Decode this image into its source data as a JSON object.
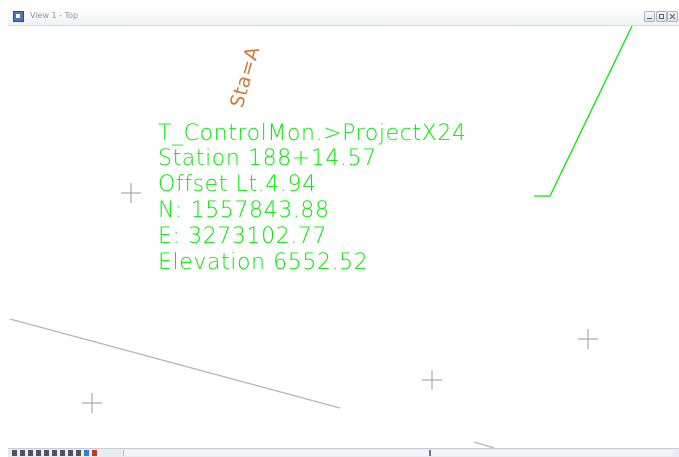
{
  "window": {
    "title": "View 1 - Top"
  },
  "annotation": {
    "line1": "T_ControlMon.>ProjectX24",
    "line2": "Station 188+14.57",
    "line3": "Offset Lt.4.94",
    "line4": "N: 1557843.88",
    "line5": "E: 3273102.77",
    "line6": "Elevation  6552.52",
    "color": "#00ee00"
  },
  "station_label": {
    "text": "Sta=A",
    "color": "#d07a3a"
  },
  "colors": {
    "alignment_line": "#00ee00",
    "edge_line": "#b8b8b8",
    "crosshair": "#9a9a9a"
  },
  "toolbar": {
    "icons": [
      "view-control-icon",
      "zoom-in-icon",
      "zoom-out-icon",
      "window-area-icon",
      "fit-view-icon",
      "rotate-view-icon",
      "pan-view-icon",
      "previous-view-icon",
      "next-view-icon",
      "view-attributes-icon",
      "display-style-icon"
    ]
  }
}
